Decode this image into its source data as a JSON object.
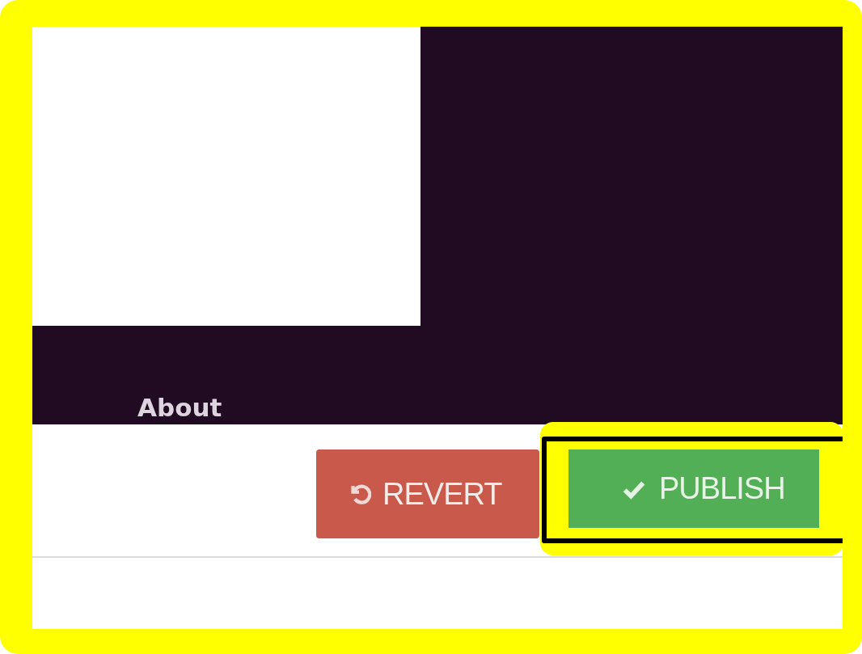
{
  "banner": {
    "link": "About"
  },
  "actions": [
    {
      "kind": "revert",
      "label": "REVERT",
      "highlighted": false
    },
    {
      "kind": "publish",
      "label": "PUBLISH",
      "highlighted": true
    }
  ]
}
